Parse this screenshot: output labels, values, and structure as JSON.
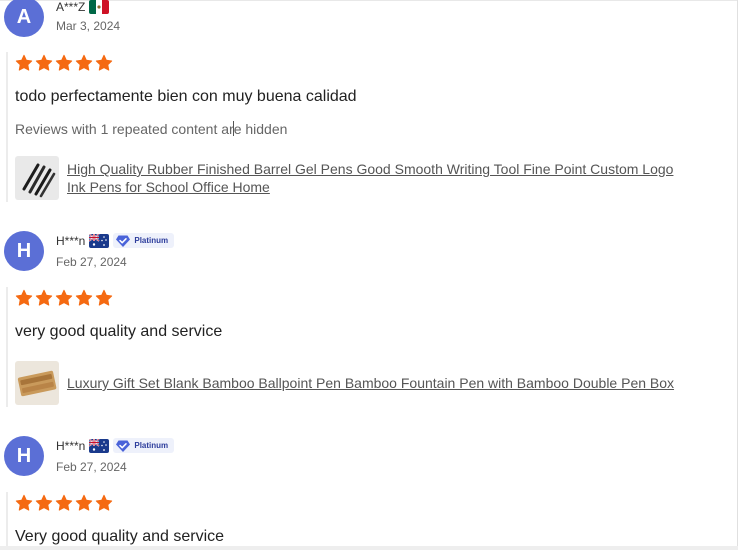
{
  "reviews": [
    {
      "initial": "A",
      "name": "A***Z",
      "flag": "mexico-flag-icon",
      "badge": "",
      "date": "Mar 3, 2024",
      "rating": 5,
      "text": "todo perfectamente bien con muy buena calidad",
      "note_before_cursor": "Reviews with 1 repeated content ar",
      "note_after_cursor": "e hidden",
      "product_line1": "High Quality Rubber Finished Barrel Gel Pens Good Smooth Writing Tool Fine Point Custom Logo",
      "product_line2": "Ink Pens for School Office Home",
      "thumb": "black-pens-thumbnail"
    },
    {
      "initial": "H",
      "name": "H***n",
      "flag": "australia-flag-icon",
      "badge": "Platinum",
      "date": "Feb 27, 2024",
      "rating": 5,
      "text": "very good quality and service",
      "product_line1": "Luxury Gift Set Blank Bamboo Ballpoint Pen Bamboo Fountain Pen with Bamboo Double Pen Box",
      "thumb": "bamboo-pen-box-thumbnail"
    },
    {
      "initial": "H",
      "name": "H***n",
      "flag": "australia-flag-icon",
      "badge": "Platinum",
      "date": "Feb 27, 2024",
      "rating": 5,
      "text": "Very good quality and service"
    }
  ],
  "colors": {
    "star": "#f56a12",
    "avatar": "#5b6fd6",
    "badge_text": "#2d3d9c",
    "badge_bg": "#eef1fb"
  }
}
